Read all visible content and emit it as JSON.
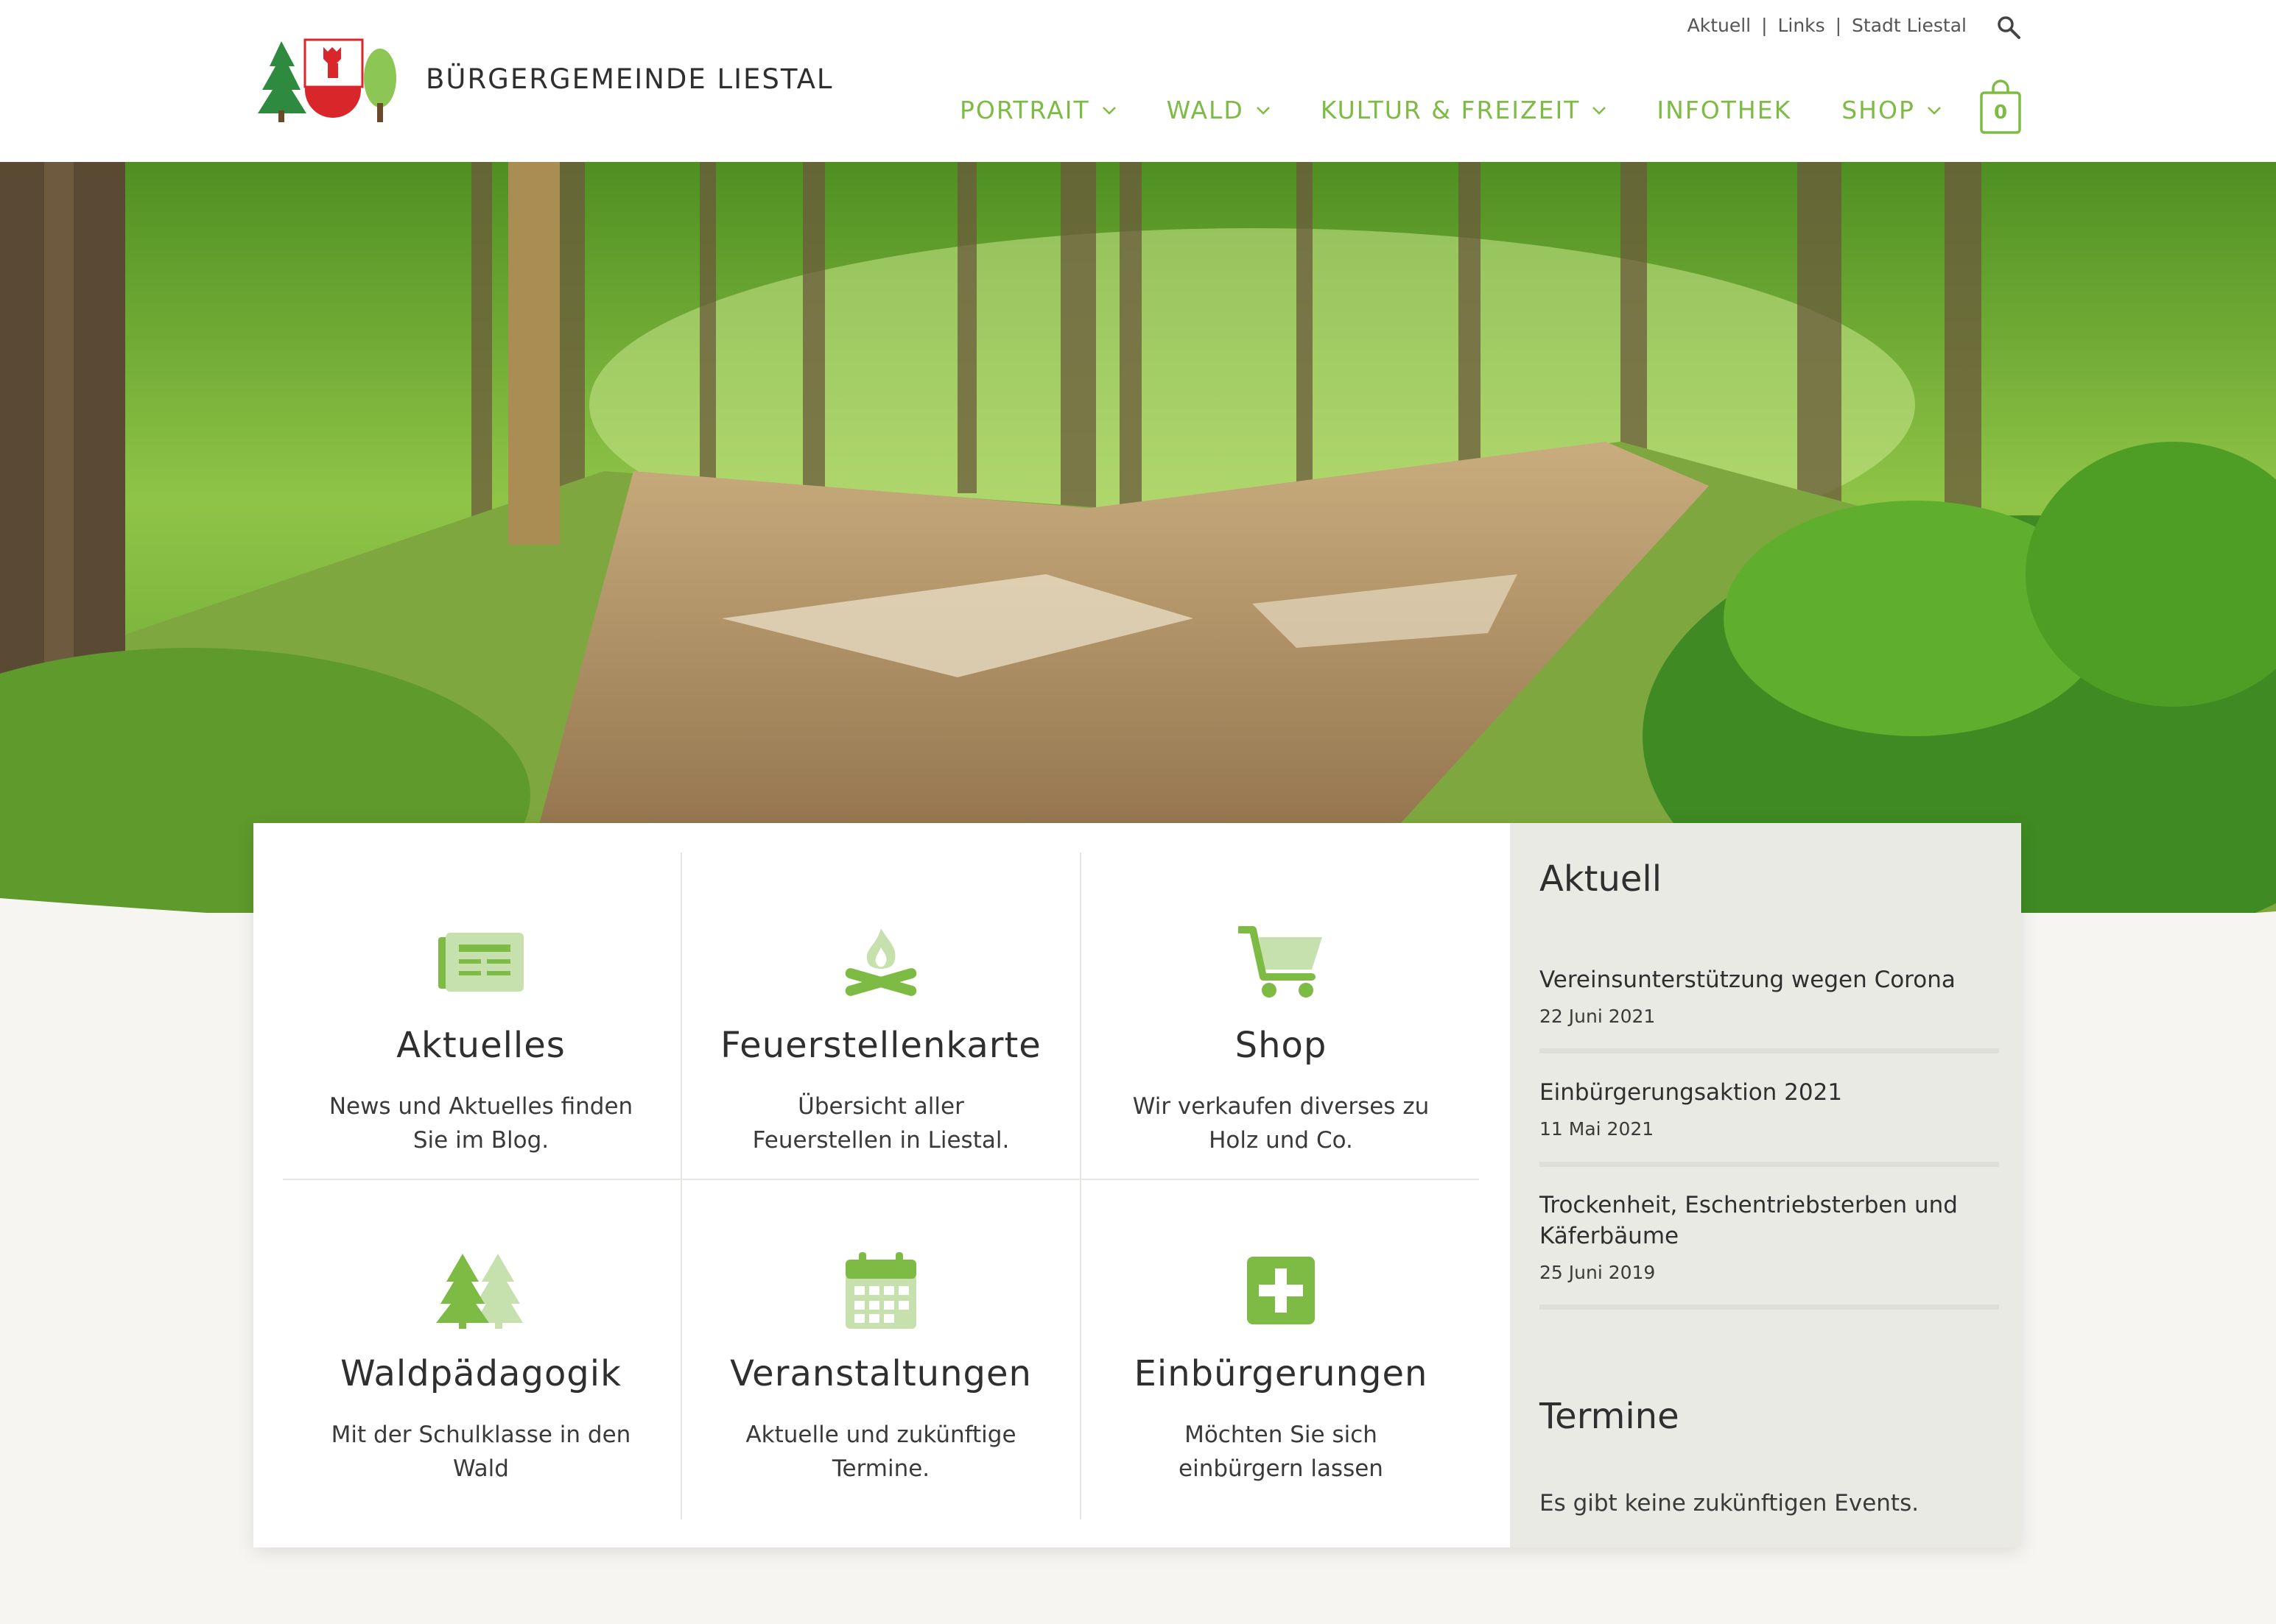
{
  "brand": {
    "name": "BÜRGERGEMEINDE LIESTAL"
  },
  "top_links": [
    "Aktuell",
    "Links",
    "Stadt Liestal"
  ],
  "top_links_separator": "|",
  "nav": [
    {
      "label": "PORTRAIT",
      "has_dropdown": true
    },
    {
      "label": "WALD",
      "has_dropdown": true
    },
    {
      "label": "KULTUR & FREIZEIT",
      "has_dropdown": true
    },
    {
      "label": "INFOTHEK",
      "has_dropdown": false
    },
    {
      "label": "SHOP",
      "has_dropdown": true
    }
  ],
  "cart": {
    "count": "0",
    "icon": "shopping-bag-icon"
  },
  "colors": {
    "accent": "#7dbb45",
    "accent_light": "#c6e1ad",
    "sidebar_bg": "#eaeae5",
    "page_bg": "#f6f5f1"
  },
  "tiles": [
    {
      "title": "Aktuelles",
      "text": "News und Aktuelles finden Sie im Blog.",
      "icon": "newspaper-icon"
    },
    {
      "title": "Feuerstellenkarte",
      "text": "Übersicht aller Feuerstellen in Liestal.",
      "icon": "campfire-icon"
    },
    {
      "title": "Shop",
      "text": "Wir verkaufen diverses zu Holz und Co.",
      "icon": "shopping-cart-icon"
    },
    {
      "title": "Waldpädagogik",
      "text": "Mit der Schulklasse in den Wald",
      "icon": "trees-icon"
    },
    {
      "title": "Veranstaltungen",
      "text": "Aktuelle und zukünftige Termine.",
      "icon": "calendar-icon"
    },
    {
      "title": "Einbürgerungen",
      "text": "Möchten Sie sich einbürgern lassen",
      "icon": "plus-square-icon"
    }
  ],
  "sidebar": {
    "news_heading": "Aktuell",
    "news": [
      {
        "title": "Vereinsunterstützung wegen Corona",
        "date": "22 Juni 2021"
      },
      {
        "title": "Einbürgerungsaktion 2021",
        "date": "11 Mai 2021"
      },
      {
        "title": "Trockenheit, Eschentriebsterben und Käferbäume",
        "date": "25 Juni 2019"
      }
    ],
    "events_heading": "Termine",
    "events_empty": "Es gibt keine zukünftigen Events."
  }
}
